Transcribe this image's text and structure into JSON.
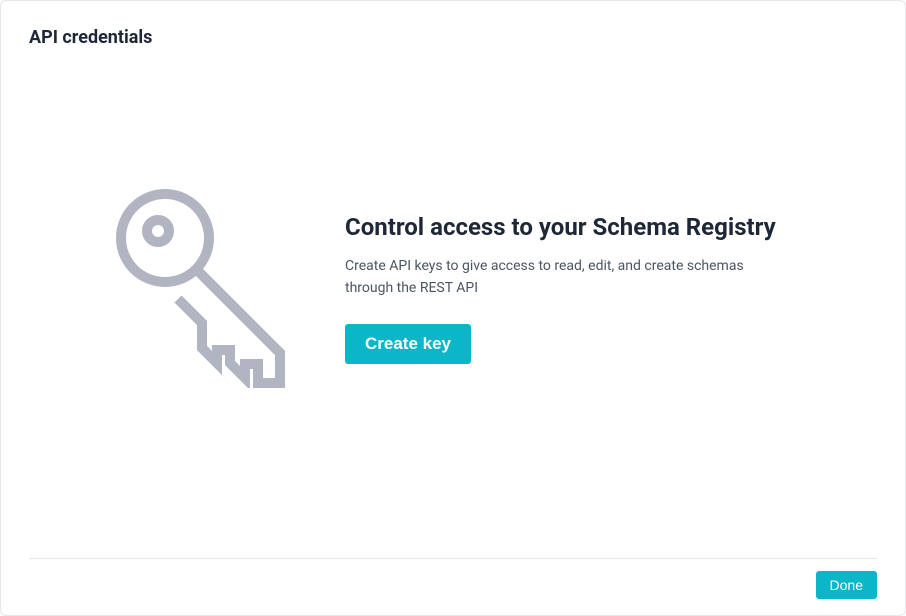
{
  "section_title": "API credentials",
  "main": {
    "heading": "Control access to your Schema Registry",
    "description": "Create API keys to give access to read, edit, and create schemas through the REST API",
    "create_key_label": "Create key"
  },
  "footer": {
    "done_label": "Done"
  },
  "icons": {
    "key": "key-icon"
  },
  "colors": {
    "accent": "#0bb6c7",
    "icon_stroke": "#b1b4c1"
  }
}
